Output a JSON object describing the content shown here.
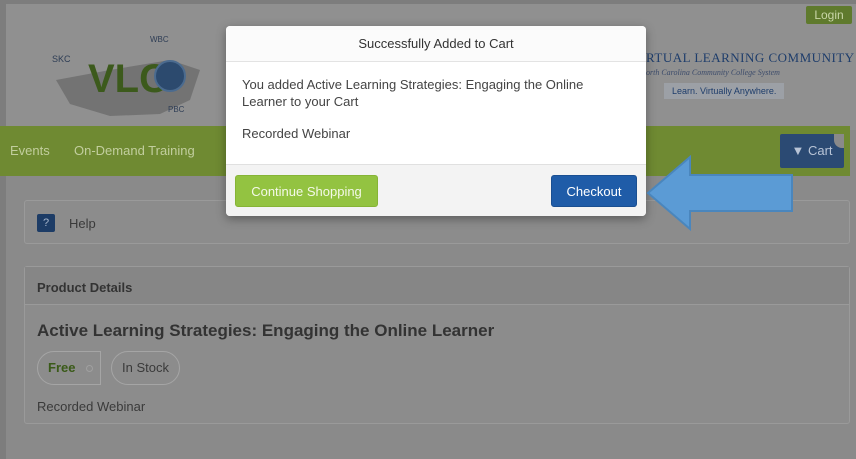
{
  "header": {
    "login_label": "Login",
    "brand_title": "RTUAL LEARNING COMMUNITY",
    "brand_subtitle": "orth Carolina Community College System",
    "brand_tagline": "Learn. Virtually Anywhere.",
    "logo_text": "VLC",
    "logo_small_left": "SKC",
    "logo_small_top": "WBC",
    "logo_small_bottom": "PBC"
  },
  "nav": {
    "items": [
      "Events",
      "On-Demand Training"
    ],
    "cart_label": "Cart"
  },
  "help": {
    "icon_label": "?",
    "label": "Help"
  },
  "product": {
    "section_label": "Product Details",
    "title": "Active Learning Strategies: Engaging the Online Learner",
    "price_tag": "Free",
    "stock_tag": "In Stock",
    "type": "Recorded Webinar"
  },
  "modal": {
    "title": "Successfully Added to Cart",
    "message": "You added Active Learning Strategies: Engaging the Online Learner to your Cart",
    "item_type": "Recorded Webinar",
    "continue_label": "Continue Shopping",
    "checkout_label": "Checkout"
  },
  "colors": {
    "nav_green": "#6f8a32",
    "continue_green": "#93c341",
    "checkout_blue": "#1f5ca8",
    "arrow_blue": "#5b9bd5"
  }
}
